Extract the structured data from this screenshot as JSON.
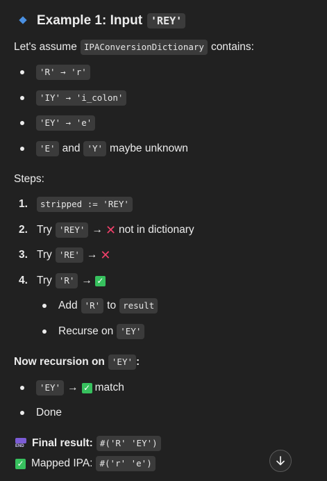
{
  "header": {
    "title": "Example 1: Input",
    "input_code": "'REY'"
  },
  "intro": {
    "prefix": "Let's assume",
    "dict_name": "IPAConversionDictionary",
    "suffix": "contains:"
  },
  "dict_entries": [
    {
      "from": "'R'",
      "arrow": "→",
      "to": "'r'"
    },
    {
      "from": "'IY'",
      "arrow": "→",
      "to": "'i_colon'"
    },
    {
      "from": "'EY'",
      "arrow": "→",
      "to": "'e'"
    }
  ],
  "unknown_item": {
    "code1": "'E'",
    "and": "and",
    "code2": "'Y'",
    "suffix": "maybe unknown"
  },
  "steps_label": "Steps:",
  "steps": {
    "s1": {
      "num": "1.",
      "code": "stripped := 'REY'"
    },
    "s2": {
      "num": "2.",
      "try": "Try",
      "code": "'REY'",
      "arrow": "→",
      "x": "✕",
      "text": "not in dictionary"
    },
    "s3": {
      "num": "3.",
      "try": "Try",
      "code": "'RE'",
      "arrow": "→",
      "x": "✕"
    },
    "s4": {
      "num": "4.",
      "try": "Try",
      "code": "'R'",
      "arrow": "→",
      "check": "✓"
    },
    "sub1": {
      "add": "Add",
      "code1": "'R'",
      "to": "to",
      "code2": "result"
    },
    "sub2": {
      "text": "Recurse on",
      "code": "'EY'"
    }
  },
  "recursion": {
    "prefix": "Now recursion on",
    "code": "'EY'",
    "colon": ":",
    "item1": {
      "code": "'EY'",
      "arrow": "→",
      "check": "✓",
      "text": "match"
    },
    "item2": "Done"
  },
  "final": {
    "icon": "end-arrow-icon",
    "label": "Final result:",
    "code": "#('R' 'EY')",
    "mapped_label": "Mapped IPA:",
    "mapped_code": "#('r' 'e')"
  },
  "colors": {
    "background": "#212121",
    "code_bg": "#3b3b3b",
    "accent_blue": "#4a90e2",
    "cross_red": "#f0406a",
    "check_green": "#37c15e"
  }
}
